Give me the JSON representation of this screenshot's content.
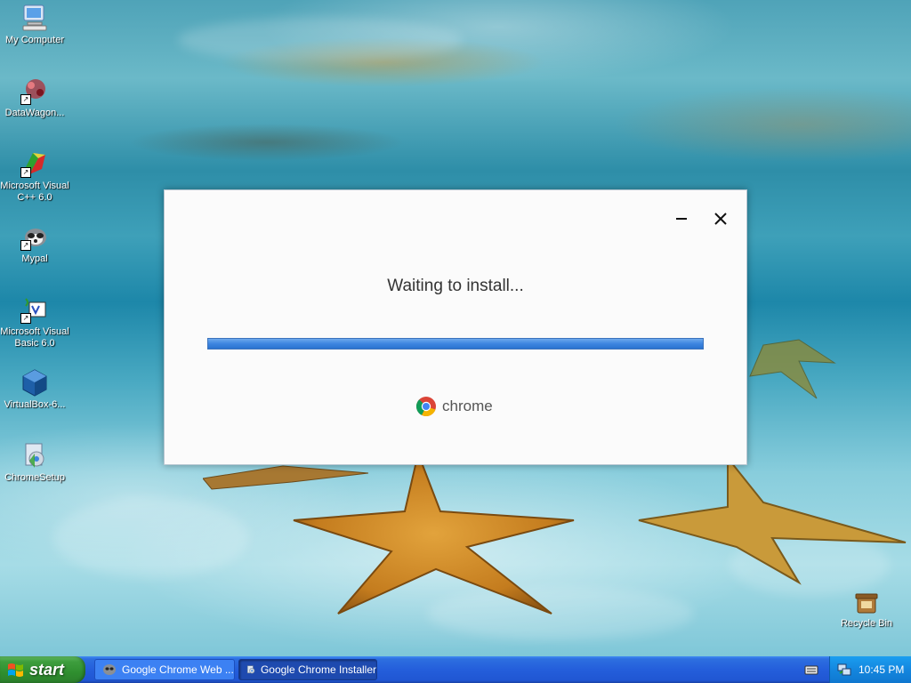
{
  "desktop": {
    "icons": [
      {
        "label": "My Computer",
        "icon": "my-computer-icon"
      },
      {
        "label": "DataWagon...",
        "icon": "datawagon-icon"
      },
      {
        "label": "Microsoft Visual C++ 6.0",
        "icon": "visual-cpp-icon"
      },
      {
        "label": "Mypal",
        "icon": "mypal-icon"
      },
      {
        "label": "Microsoft Visual Basic 6.0",
        "icon": "visual-basic-icon"
      },
      {
        "label": "VirtualBox-6...",
        "icon": "virtualbox-icon"
      },
      {
        "label": "ChromeSetup",
        "icon": "chrome-setup-icon"
      },
      {
        "label": "Recycle Bin",
        "icon": "recycle-bin-icon"
      }
    ]
  },
  "installer": {
    "status": "Waiting to install...",
    "progress_fraction": 1.0,
    "brand": "chrome",
    "minimize_icon": "minimize-icon",
    "close_icon": "close-icon"
  },
  "taskbar": {
    "start_label": "start",
    "tasks": [
      {
        "label": "Google Chrome Web ...",
        "active": false
      },
      {
        "label": "Google Chrome Installer",
        "active": true
      }
    ],
    "clock": "10:45 PM"
  }
}
